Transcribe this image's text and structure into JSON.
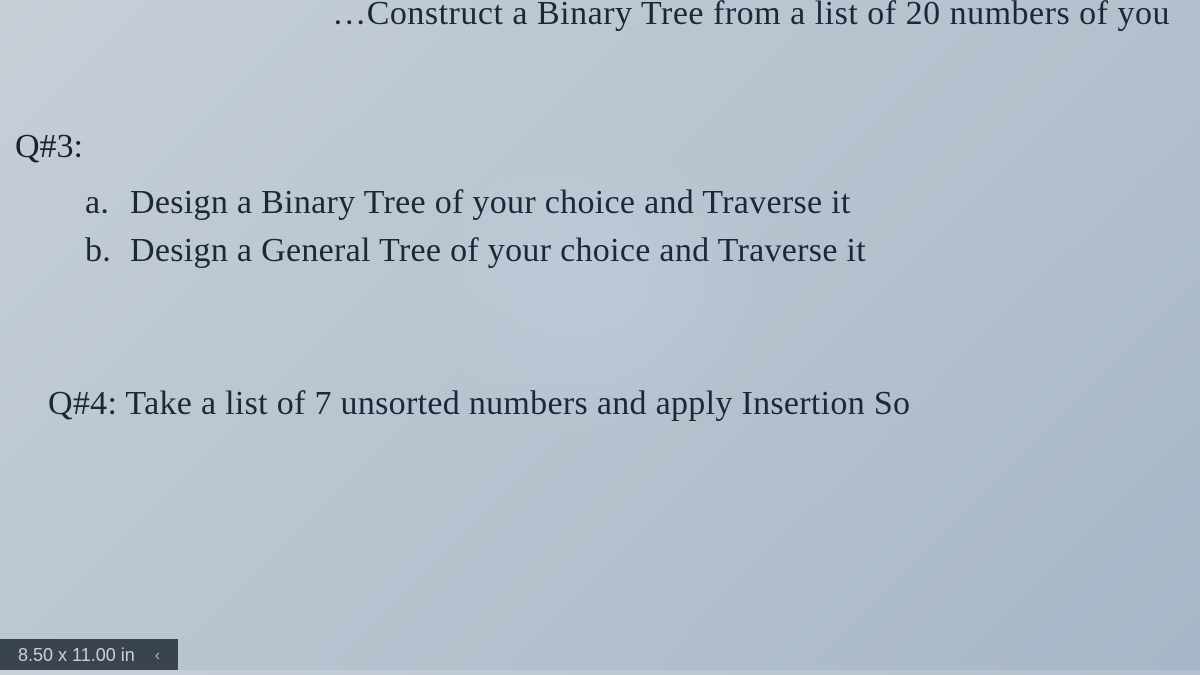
{
  "top_fragment": "…Construct a Binary Tree from a list of 20 numbers of you",
  "q3": {
    "heading": "Q#3:",
    "items": [
      {
        "marker": "a.",
        "text": "Design a Binary Tree of your choice and Traverse it"
      },
      {
        "marker": "b.",
        "text": "Design a General Tree of your choice and Traverse it"
      }
    ]
  },
  "q4": {
    "text": "Q#4: Take a list of 7 unsorted numbers and apply Insertion So"
  },
  "status": {
    "dimensions": "8.50 x 11.00 in",
    "chevron": "‹"
  }
}
